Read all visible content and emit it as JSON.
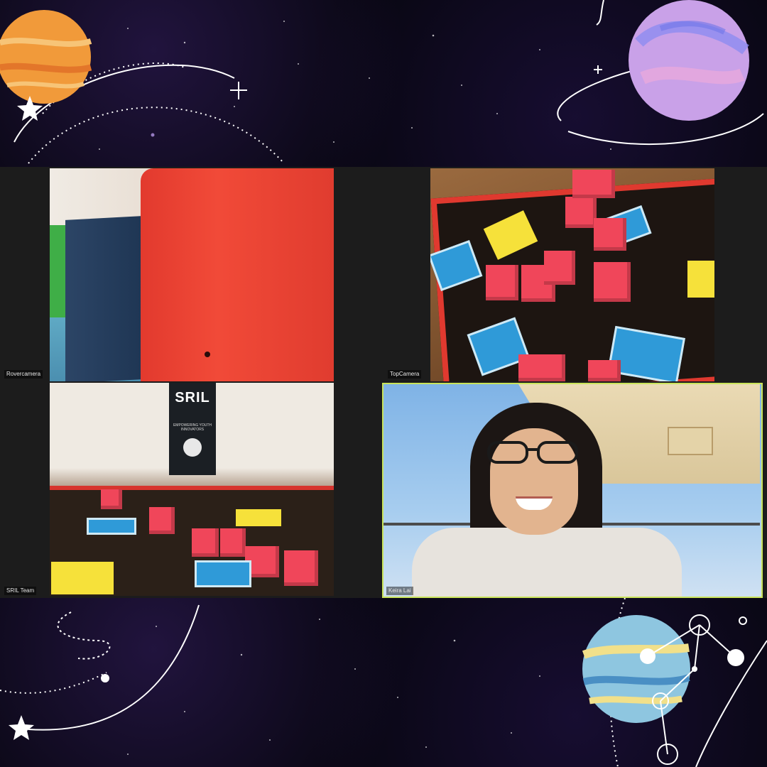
{
  "participants": [
    {
      "name": "Rovercamera"
    },
    {
      "name": "TopCamera"
    },
    {
      "name": "SRIL Team"
    },
    {
      "name": "Keira Lai"
    }
  ],
  "sril_banner": {
    "logo": "SRIL",
    "tagline": "EMPOWERING YOUTH INNOVATORS"
  },
  "colors": {
    "active_speaker_border": "#c9e35a",
    "label_text": "#e6e6e6",
    "gallery_background": "#1c1c1c"
  },
  "icons": [
    "orange-planet-icon",
    "purple-planet-icon",
    "blue-yellow-planet-icon",
    "star-icon",
    "sparkle-icon",
    "orbit-icon",
    "constellation-icon"
  ]
}
